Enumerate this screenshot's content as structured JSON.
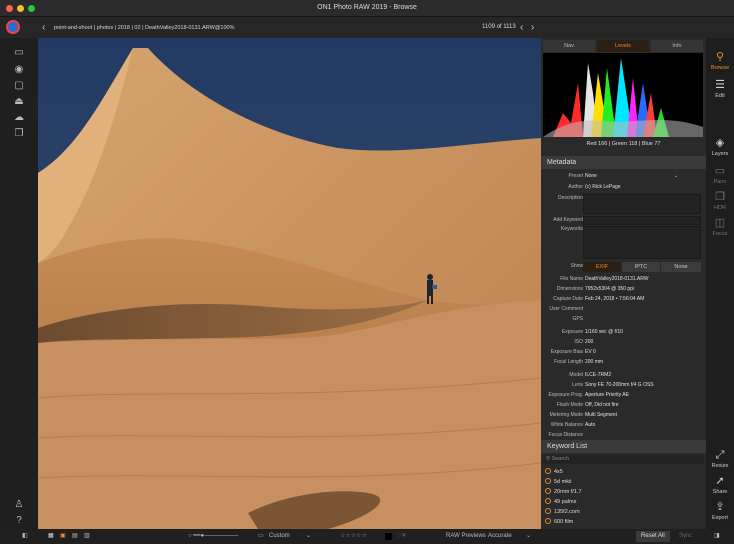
{
  "window": {
    "title": "ON1 Photo RAW 2019 - Browse"
  },
  "crumbs": {
    "path": "point-and-shoot | photos | 2018 | 02 | DeathValley2018-0131.ARW@100%",
    "counter": "1109 of 1113"
  },
  "photo": {
    "alt": "Death Valley sand dunes with a photographer"
  },
  "tabs": {
    "nav": "Nav",
    "levels": "Levels",
    "info": "Info"
  },
  "rgb_readout": "Red 166 | Green 118 | Blue  77",
  "metadata": {
    "title": "Metadata",
    "preset_label": "Preset",
    "preset_value": "None",
    "author_label": "Author",
    "author_value": "(c) Rick LePage",
    "description_label": "Description",
    "add_keyword_label": "Add Keyword",
    "keywords_label": "Keywords",
    "show_label": "Show",
    "show_options": [
      "EXIF",
      "IPTC",
      "None"
    ],
    "rows": [
      {
        "k": "File Name",
        "v": "DeathValley2018-0131.ARW"
      },
      {
        "k": "Dimensions",
        "v": "7952x5304 @ 350 ppi"
      },
      {
        "k": "Capture Date",
        "v": "Feb 24, 2018 • 7:56:04 AM"
      },
      {
        "k": "User Comment",
        "v": ""
      },
      {
        "k": "GPS",
        "v": ""
      },
      {
        "k": "Exposure",
        "v": "1/160 sec @ f/10"
      },
      {
        "k": "ISO",
        "v": "200"
      },
      {
        "k": "Exposure Bias",
        "v": "EV 0"
      },
      {
        "k": "Focal Length",
        "v": "200 mm"
      },
      {
        "k": "Model",
        "v": "ILCE-7RM2"
      },
      {
        "k": "Lens",
        "v": "Sony FE 70-200mm f/4 G OSS"
      },
      {
        "k": "Exposure Prog.",
        "v": "Aperture Priority AE"
      },
      {
        "k": "Flash Mode",
        "v": "Off, Did not fire"
      },
      {
        "k": "Metering Mode",
        "v": "Multi Segment"
      },
      {
        "k": "White Balance",
        "v": "Auto"
      },
      {
        "k": "Focus Distance",
        "v": ""
      }
    ]
  },
  "keywords": {
    "title": "Keyword List",
    "search_placeholder": "Search",
    "items": [
      "4x5",
      "5d mkii",
      "20mm f/1.7",
      "49 palms",
      "135f2.com",
      "600 film"
    ]
  },
  "right_tools": {
    "browse": "Browse",
    "edit": "Edit",
    "layers": "Layers",
    "pano": "Pano",
    "hdr": "HDR",
    "focus": "Focus",
    "resize": "Resize",
    "share": "Share",
    "export": "Export"
  },
  "bottom": {
    "custom": "Custom",
    "raw_previews": "RAW Previews",
    "accurate": "Accurate",
    "reset_all": "Reset All",
    "sync": "Sync",
    "stars": "☆☆☆☆☆"
  },
  "colors": {
    "accent": "#f08a2c",
    "sky": "#2b3f66",
    "sand": "#c9925f"
  }
}
